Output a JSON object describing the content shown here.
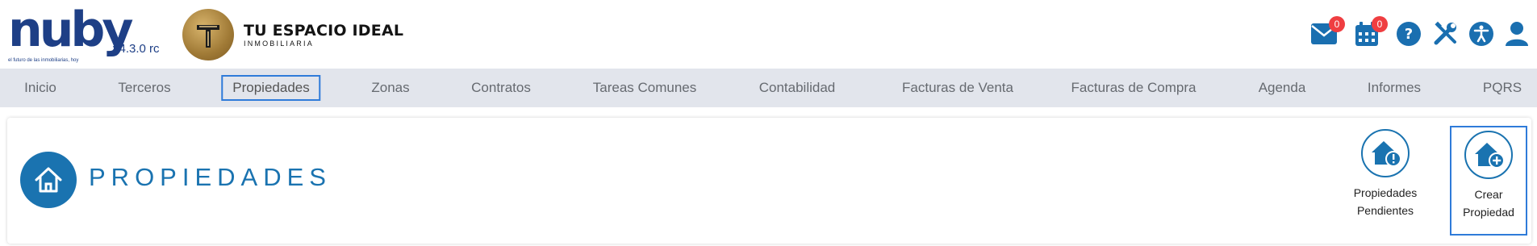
{
  "app": {
    "logo_text": "nuby",
    "version": "v4.3.0 rc",
    "tagline": "el futuro de las inmobiliarias, hoy"
  },
  "brand": {
    "name": "TU ESPACIO IDEAL",
    "subtitle": "INMOBILIARIA"
  },
  "header": {
    "messages_count": "0",
    "calendar_count": "0",
    "icons": [
      "envelope-icon",
      "calendar-icon",
      "help-icon",
      "tools-icon",
      "accessibility-icon",
      "user-icon"
    ]
  },
  "nav": {
    "items": [
      {
        "label": "Inicio"
      },
      {
        "label": "Terceros"
      },
      {
        "label": "Propiedades",
        "active": true
      },
      {
        "label": "Zonas"
      },
      {
        "label": "Contratos"
      },
      {
        "label": "Tareas Comunes"
      },
      {
        "label": "Contabilidad"
      },
      {
        "label": "Facturas de Venta"
      },
      {
        "label": "Facturas de Compra"
      },
      {
        "label": "Agenda"
      },
      {
        "label": "Informes"
      },
      {
        "label": "PQRS"
      }
    ]
  },
  "page": {
    "title": "PROPIEDADES",
    "actions": [
      {
        "line1": "Propiedades",
        "line2": "Pendientes",
        "icon": "home-alert-icon"
      },
      {
        "line1": "Crear",
        "line2": "Propiedad",
        "icon": "home-add-icon"
      }
    ]
  },
  "colors": {
    "primary": "#1a73b0",
    "logo": "#1e3f86",
    "nav_bg": "#e2e5ec",
    "badge": "#ef3e41",
    "focus_border": "#2f7bd9"
  }
}
